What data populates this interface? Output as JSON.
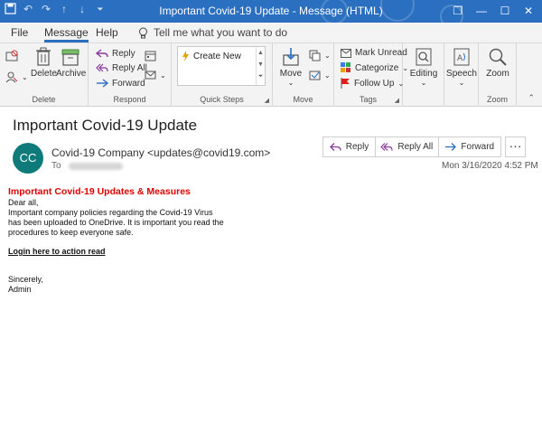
{
  "window": {
    "title": "Important Covid-19 Update  -  Message (HTML)",
    "controls": {
      "restore": "❐",
      "minimize": "—",
      "maximize": "☐",
      "close": "✕"
    }
  },
  "menu": {
    "tabs": [
      "File",
      "Message",
      "Help"
    ],
    "active_tab": "Message",
    "tell_me": "Tell me what you want to do"
  },
  "ribbon": {
    "delete_group": {
      "label": "Delete",
      "delete": "Delete",
      "archive": "Archive"
    },
    "respond_group": {
      "label": "Respond",
      "reply": "Reply",
      "reply_all": "Reply All",
      "forward": "Forward"
    },
    "quick_steps_group": {
      "label": "Quick Steps",
      "create_new": "Create New"
    },
    "move_group": {
      "label": "Move",
      "move": "Move"
    },
    "tags_group": {
      "label": "Tags",
      "mark_unread": "Mark Unread",
      "categorize": "Categorize",
      "follow_up": "Follow Up"
    },
    "editing_group": {
      "editing": "Editing"
    },
    "speech_group": {
      "speech": "Speech"
    },
    "zoom_group": {
      "label": "Zoom",
      "zoom": "Zoom"
    }
  },
  "message": {
    "subject": "Important Covid-19 Update",
    "avatar_initials": "CC",
    "sender": "Covid-19 Company <updates@covid19.com>",
    "to_label": "To",
    "date": "Mon 3/16/2020 4:52 PM",
    "actions": {
      "reply": "Reply",
      "reply_all": "Reply All",
      "forward": "Forward",
      "more": "···"
    },
    "body": {
      "heading": "Important Covid-19 Updates & Measures",
      "greeting": "Dear all,",
      "line1": "Important company policies regarding the Covid-19 Virus",
      "line2": "has been uploaded to OneDrive. It is important you read the",
      "line3": "procedures to keep everyone safe.",
      "link": "Login here to action read",
      "closing": "Sincerely,",
      "signature": "Admin"
    }
  },
  "colors": {
    "titlebar": "#2b6fc0",
    "avatar": "#0e7a7a",
    "heading_red": "#e00000"
  }
}
